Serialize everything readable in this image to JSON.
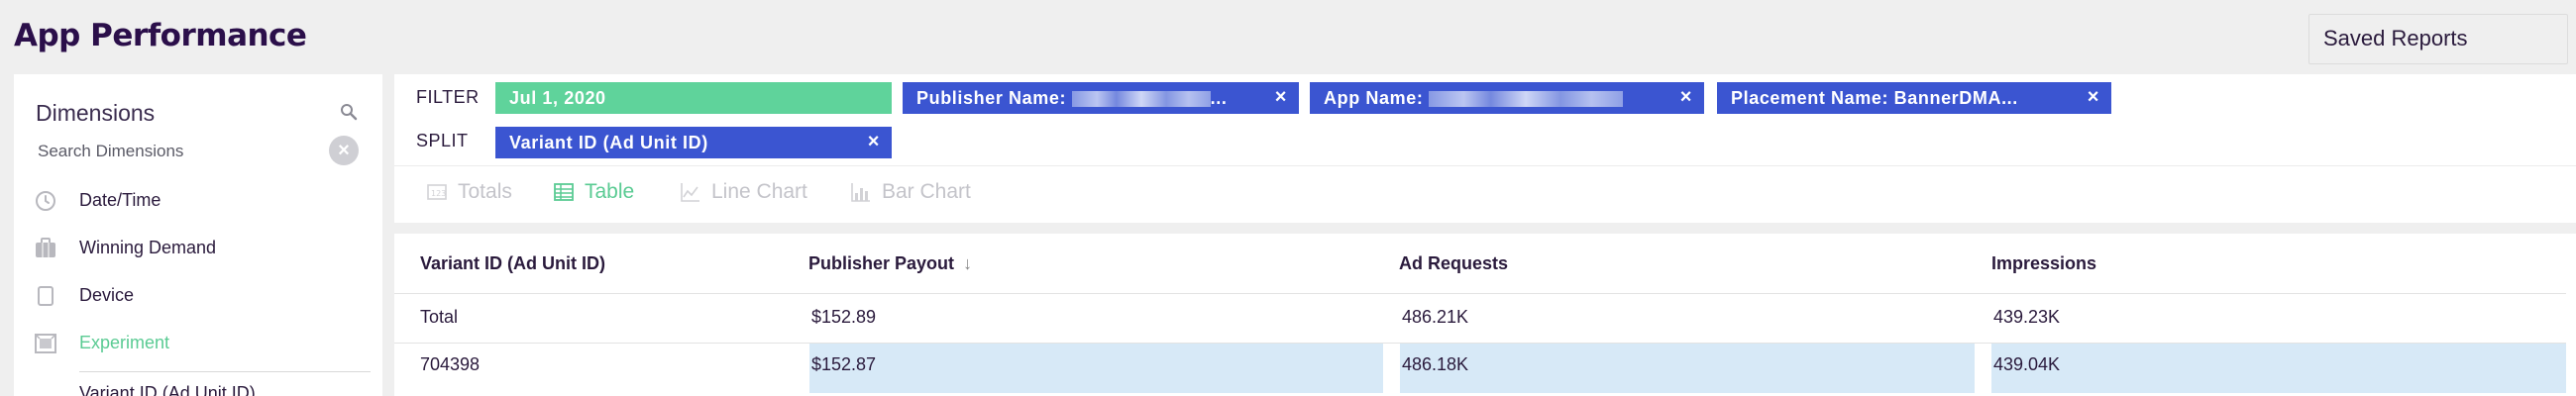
{
  "header": {
    "title": "App Performance",
    "saved_reports_label": "Saved Reports"
  },
  "sidebar": {
    "title": "Dimensions",
    "search_placeholder": "Search Dimensions",
    "items": [
      {
        "label": "Date/Time",
        "icon": "clock-icon"
      },
      {
        "label": "Winning Demand",
        "icon": "briefcase-icon"
      },
      {
        "label": "Device",
        "icon": "device-icon"
      },
      {
        "label": "Experiment",
        "icon": "experiment-icon",
        "active": true
      }
    ],
    "sub_item": "Variant ID (Ad Unit ID)"
  },
  "filters": {
    "filter_label": "FILTER",
    "split_label": "SPLIT",
    "filter_chips": [
      {
        "text": "Jul 1, 2020",
        "color": "#5fd39b"
      },
      {
        "text": "Publisher Name: ",
        "color": "#3b55d1",
        "redacted": true,
        "suffix": "..."
      },
      {
        "text": "App Name: ",
        "color": "#3b55d1",
        "redacted": true
      },
      {
        "text": "Placement Name: BannerDMA...",
        "color": "#3b55d1"
      }
    ],
    "split_chips": [
      {
        "text": "Variant ID (Ad Unit ID)",
        "color": "#3b55d1"
      }
    ],
    "close_glyph": "×"
  },
  "visualizations": [
    {
      "label": "Totals",
      "icon": "totals-icon",
      "active": false
    },
    {
      "label": "Table",
      "icon": "table-icon",
      "active": true
    },
    {
      "label": "Line Chart",
      "icon": "line-chart-icon",
      "active": false
    },
    {
      "label": "Bar Chart",
      "icon": "bar-chart-icon",
      "active": false
    }
  ],
  "table": {
    "columns": [
      "Variant ID (Ad Unit ID)",
      "Publisher Payout",
      "Ad Requests",
      "Impressions"
    ],
    "sort_indicator": "↓",
    "rows": [
      [
        "Total",
        "$152.89",
        "486.21K",
        "439.23K"
      ],
      [
        "704398",
        "$152.87",
        "486.18K",
        "439.04K"
      ]
    ],
    "highlight_color": "#d7e9f7"
  },
  "colors": {
    "accent_green": "#5fd39b",
    "chip_blue": "#3b55d1",
    "title_purple": "#2b0f4a"
  }
}
